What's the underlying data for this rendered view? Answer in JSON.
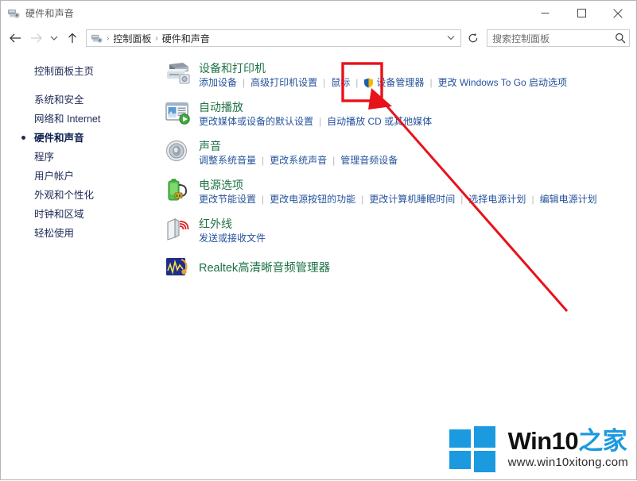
{
  "window": {
    "title": "硬件和声音",
    "title_icon": "hardware-sound-icon",
    "minimize_label": "最小化",
    "maximize_label": "最大化",
    "close_label": "关闭"
  },
  "nav": {
    "back_label": "后退",
    "forward_label": "前进",
    "recent_label": "最近浏览的位置",
    "up_label": "上移一级",
    "refresh_label": "刷新",
    "breadcrumb": [
      "控制面板",
      "硬件和声音"
    ],
    "breadcrumb_sep": "›"
  },
  "search": {
    "placeholder": "搜索控制面板",
    "icon": "search-icon"
  },
  "sidebar": {
    "home": "控制面板主页",
    "items": [
      {
        "label": "系统和安全",
        "active": false
      },
      {
        "label": "网络和 Internet",
        "active": false
      },
      {
        "label": "硬件和声音",
        "active": true
      },
      {
        "label": "程序",
        "active": false
      },
      {
        "label": "用户帐户",
        "active": false
      },
      {
        "label": "外观和个性化",
        "active": false
      },
      {
        "label": "时钟和区域",
        "active": false
      },
      {
        "label": "轻松使用",
        "active": false
      }
    ]
  },
  "categories": [
    {
      "icon": "printer-icon",
      "title": "设备和打印机",
      "links": [
        {
          "label": "添加设备",
          "shield": false
        },
        {
          "label": "高级打印机设置",
          "shield": false
        },
        {
          "label": "鼠标",
          "shield": false,
          "highlighted": true
        },
        {
          "label": "设备管理器",
          "shield": true
        },
        {
          "label": "更改 Windows To Go 启动选项",
          "shield": false
        }
      ]
    },
    {
      "icon": "autoplay-icon",
      "title": "自动播放",
      "links": [
        {
          "label": "更改媒体或设备的默认设置",
          "shield": false
        },
        {
          "label": "自动播放 CD 或其他媒体",
          "shield": false
        }
      ]
    },
    {
      "icon": "sound-icon",
      "title": "声音",
      "links": [
        {
          "label": "调整系统音量",
          "shield": false
        },
        {
          "label": "更改系统声音",
          "shield": false
        },
        {
          "label": "管理音频设备",
          "shield": false
        }
      ]
    },
    {
      "icon": "power-icon",
      "title": "电源选项",
      "links": [
        {
          "label": "更改节能设置",
          "shield": false
        },
        {
          "label": "更改电源按钮的功能",
          "shield": false
        },
        {
          "label": "更改计算机睡眠时间",
          "shield": false
        },
        {
          "label": "选择电源计划",
          "shield": false
        },
        {
          "label": "编辑电源计划",
          "shield": false
        }
      ]
    },
    {
      "icon": "infrared-icon",
      "title": "红外线",
      "links": [
        {
          "label": "发送或接收文件",
          "shield": false
        }
      ]
    },
    {
      "icon": "realtek-icon",
      "title": "Realtek高清晰音频管理器",
      "links": []
    }
  ],
  "annotation": {
    "color": "#e8121a",
    "box_label": "鼠标高亮框",
    "arrow_label": "指向鼠标的箭头"
  },
  "watermark": {
    "logo": "windows-logo-icon",
    "brand_main": "Win10",
    "brand_suffix": "之家",
    "url": "www.win10xitong.com",
    "colors": {
      "logo": "#1b9ae0",
      "accent": "#1b9ae0"
    }
  }
}
